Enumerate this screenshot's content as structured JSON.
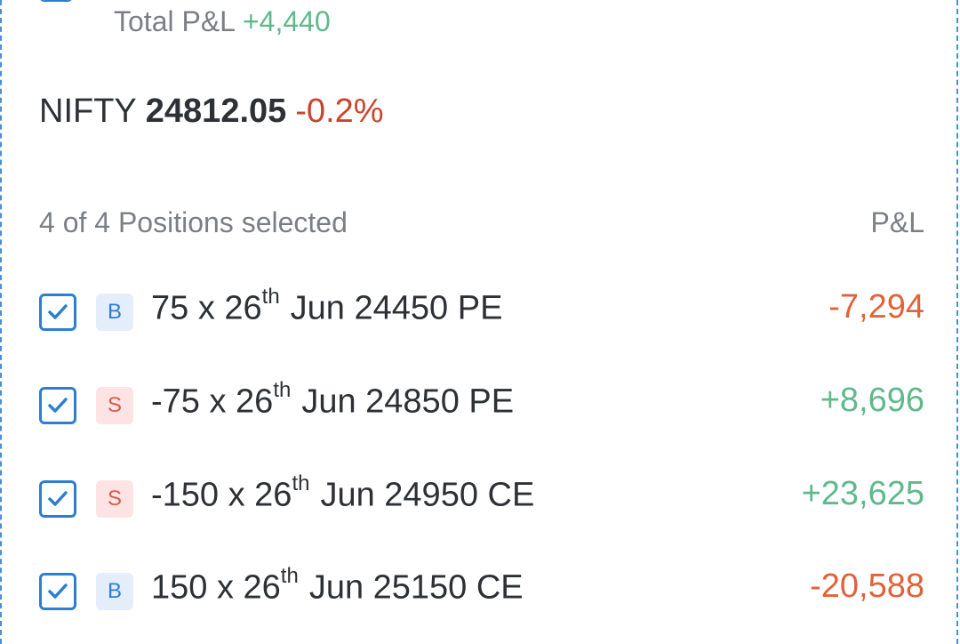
{
  "summary": {
    "total_pl_label": "Total P&L",
    "total_pl_value": "+4,440"
  },
  "index": {
    "name": "NIFTY",
    "price": "24812.05",
    "change": "-0.2%"
  },
  "positions": {
    "selection_text": "4 of 4 Positions selected",
    "pl_header": "P&L",
    "rows": [
      {
        "side": "B",
        "qty": "75 x 26",
        "ordinal": "th",
        "contract": "Jun 24450 PE",
        "pl": "-7,294",
        "checked": true
      },
      {
        "side": "S",
        "qty": "-75 x 26",
        "ordinal": "th",
        "contract": "Jun 24850 PE",
        "pl": "+8,696",
        "checked": true
      },
      {
        "side": "S",
        "qty": "-150 x 26",
        "ordinal": "th",
        "contract": "Jun 24950 CE",
        "pl": "+23,625",
        "checked": true
      },
      {
        "side": "B",
        "qty": "150 x 26",
        "ordinal": "th",
        "contract": "Jun 25150 CE",
        "pl": "-20,588",
        "checked": true
      }
    ]
  },
  "colors": {
    "accent": "#2c7fd0",
    "profit": "#5fb98b",
    "loss": "#e0633a",
    "index_change": "#c8452b"
  }
}
